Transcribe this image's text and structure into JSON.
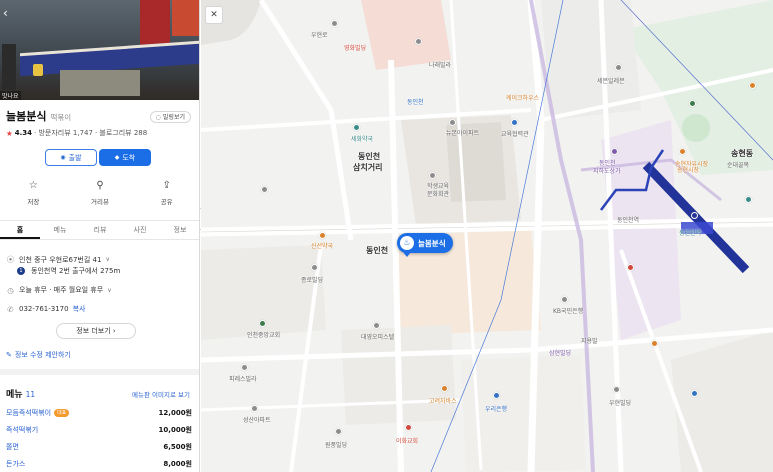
{
  "panel": {
    "photo_sign_text": "맛나요",
    "place_name": "늘봄분식",
    "category": "떡볶이",
    "voice_button": "밀링보기",
    "rating": "4.34",
    "visitor_reviews": "· 방문자리뷰 1,747",
    "blog_reviews": "· 블로그리뷰 288",
    "depart_label": "출발",
    "arrive_label": "도착",
    "actions": [
      {
        "icon": "star-icon",
        "label": "저장"
      },
      {
        "icon": "pin-icon",
        "label": "거리뷰"
      },
      {
        "icon": "share-icon",
        "label": "공유"
      }
    ],
    "tabs": [
      "홈",
      "메뉴",
      "리뷰",
      "사진",
      "정보"
    ],
    "address": "인천 중구 우현로67번길 41",
    "subway_line": "1",
    "subway_text": "동인천역 2번 출구에서 275m",
    "hours": "오늘 휴무 · 매주 월요일 휴무",
    "phone": "032-761-3170",
    "phone_copy": "복사",
    "more_info": "정보 더보기",
    "suggest": "정보 수정 제안하기",
    "menu_title": "메뉴",
    "menu_count": "11",
    "menu_image_link": "메뉴판 이미지로 보기",
    "menu_items": [
      {
        "name": "모듬즉석떡볶이",
        "badge": "대표",
        "price": "12,000원"
      },
      {
        "name": "즉석떡볶기",
        "badge": "",
        "price": "10,000원"
      },
      {
        "name": "쫄면",
        "badge": "",
        "price": "6,500원"
      },
      {
        "name": "돈가스",
        "badge": "",
        "price": "8,000원"
      }
    ]
  },
  "map": {
    "marker_label": "늘봄분식",
    "labels": {
      "dongincheon_district": "동인천",
      "samgeori": "삼치거리",
      "student_center": "학생교육",
      "student_center2": "문화회관",
      "dongincheon_main": "동인천",
      "station_name": "동인천역",
      "songhyeon": "송현동",
      "sundaegol": "순대골목",
      "newbee": "뉴본아이파트",
      "dongincheon_church": "동인천",
      "jungang_market": "동인천",
      "jungang_market2": "지하도상가",
      "sechyeon": "세화약국",
      "jongro": "종로빌딩",
      "sinseon": "신선약국",
      "bank_woori": "우리은행",
      "kb": "KB국민은행",
      "daeyeong": "대영오피스텔",
      "sanga_mall": "송현자유시장",
      "sehwa_mart": "세븐일레븐",
      "pireseu": "피레스빌라",
      "seongseon": "성산아파트",
      "jeil_gongwon": "인천중앙교회",
      "wonp": "원풍빌딩",
      "ewha": "이화교회",
      "gokyeong": "고려자바스",
      "jiyong": "지용빌",
      "sanhyeon": "삼현빌딩",
      "uhyun": "우현빌딩",
      "songhyeon_jayu": "송현시장",
      "dongin_station_exit": "동인천역",
      "gyoyuk": "교육협력관",
      "cafe": "케이크하우스",
      "nareum": "나래빌라",
      "yeong": "영화빌딩",
      "woohyeon": "우현로"
    }
  }
}
